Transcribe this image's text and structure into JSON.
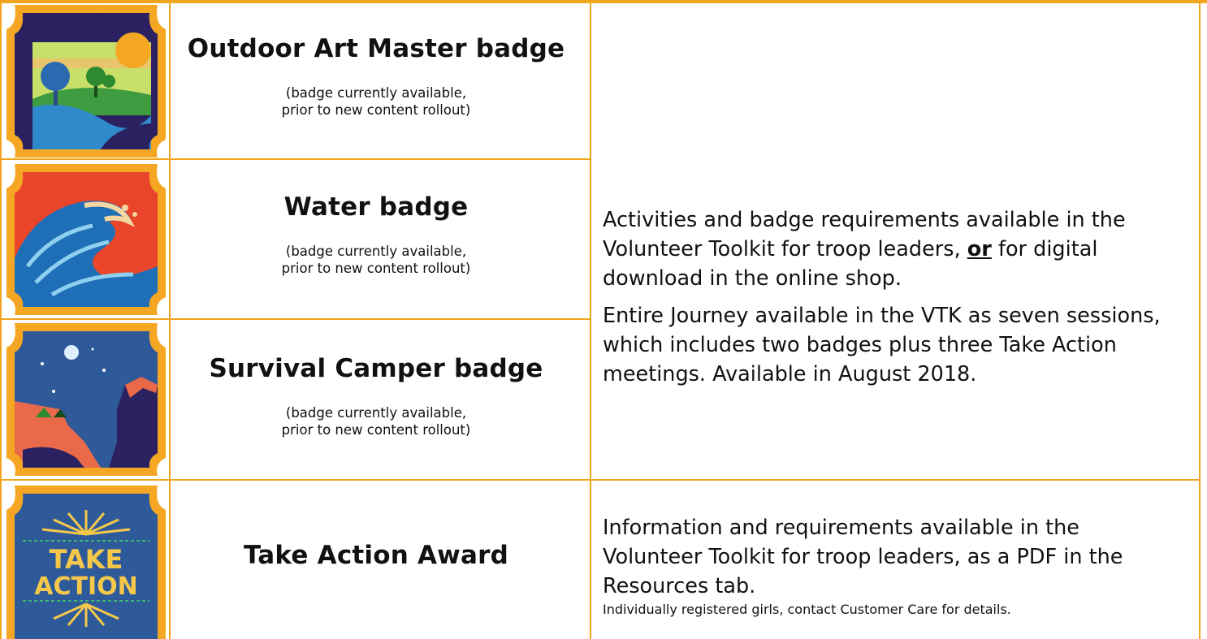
{
  "rows": [
    {
      "title": "Outdoor Art Master badge",
      "note_line1": "(badge currently available,",
      "note_line2": "prior to new content rollout)",
      "icon": "outdoor-art-badge-icon"
    },
    {
      "title": "Water badge",
      "note_line1": "(badge currently available,",
      "note_line2": "prior to new content rollout)",
      "icon": "water-badge-icon"
    },
    {
      "title": "Survival Camper badge",
      "note_line1": "(badge currently available,",
      "note_line2": "prior to new content rollout)",
      "icon": "survival-camper-badge-icon"
    },
    {
      "title": "Take Action Award",
      "icon": "take-action-badge-icon",
      "badge_text_line1": "TAKE",
      "badge_text_line2": "ACTION"
    }
  ],
  "group_description": {
    "p1_before": "Activities and badge requirements available in the Volunteer Toolkit for troop leaders, ",
    "p1_or": "or",
    "p1_after": " for digital download in the online shop.",
    "p2": "Entire Journey available in the VTK as seven sessions, which includes two badges plus three Take Action meetings. Available in August 2018."
  },
  "take_action_description": {
    "main": "Information and requirements available in the Volunteer Toolkit for troop leaders, as a PDF in the Resources tab.",
    "small": "Individually registered girls, contact Customer Care for details."
  },
  "colors": {
    "border": "#f0a51e",
    "badge_frame": "#f5a623",
    "navy": "#2b2160"
  }
}
